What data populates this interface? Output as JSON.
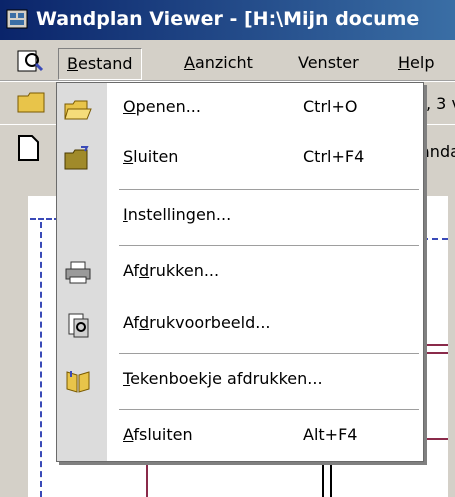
{
  "window": {
    "title": "Wandplan Viewer - [H:\\Mijn docume"
  },
  "menubar": {
    "items": [
      {
        "label": "Bestand",
        "mnemonic": "B",
        "rest": "estand"
      },
      {
        "label": "Aanzicht",
        "mnemonic": "A",
        "rest": "anzicht"
      },
      {
        "label": "Venster",
        "mnemonic": "",
        "rest": "Venster"
      },
      {
        "label": "Help",
        "mnemonic": "H",
        "rest": "elp"
      }
    ]
  },
  "background_fragments": {
    "toolbar_right": ", 3 v",
    "tab_right": "anda"
  },
  "file_menu": {
    "items": [
      {
        "pre": "",
        "mn": "O",
        "post": "penen...",
        "shortcut": "Ctrl+O",
        "icon": "open-folder-icon"
      },
      {
        "pre": "",
        "mn": "S",
        "post": "luiten",
        "shortcut": "Ctrl+F4",
        "icon": "close-folder-icon"
      },
      {
        "pre": "",
        "mn": "I",
        "post": "nstellingen...",
        "shortcut": "",
        "icon": ""
      },
      {
        "pre": "Af",
        "mn": "d",
        "post": "rukken...",
        "shortcut": "",
        "icon": "printer-icon"
      },
      {
        "pre": "Af",
        "mn": "d",
        "post": "rukvoorbeeld...",
        "shortcut": "",
        "icon": "print-preview-icon"
      },
      {
        "pre": "",
        "mn": "T",
        "post": "ekenboekje afdrukken...",
        "shortcut": "",
        "icon": "book-icon"
      },
      {
        "pre": "",
        "mn": "A",
        "post": "fsluiten",
        "shortcut": "Alt+F4",
        "icon": ""
      }
    ]
  }
}
